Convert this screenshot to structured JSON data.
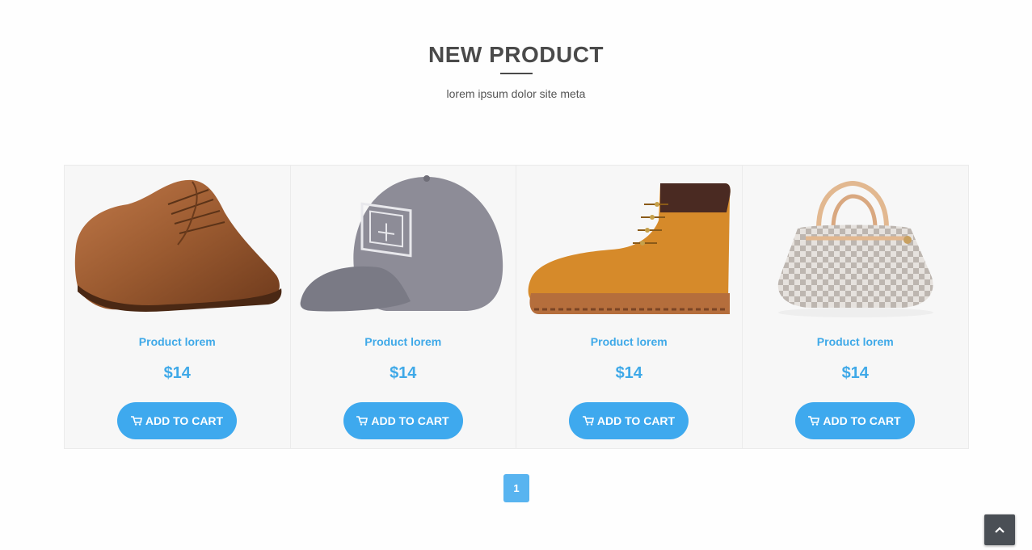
{
  "header": {
    "title": "NEW PRODUCT",
    "subtitle": "lorem ipsum dolor site meta"
  },
  "products": [
    {
      "name": "Product lorem",
      "price": "$14",
      "button_label": "ADD TO CART",
      "image": "brown-leather-shoe"
    },
    {
      "name": "Product lorem",
      "price": "$14",
      "button_label": "ADD TO CART",
      "image": "gray-baseball-cap"
    },
    {
      "name": "Product lorem",
      "price": "$14",
      "button_label": "ADD TO CART",
      "image": "tan-work-boot"
    },
    {
      "name": "Product lorem",
      "price": "$14",
      "button_label": "ADD TO CART",
      "image": "checkered-handbag"
    }
  ],
  "pagination": {
    "current_page": "1"
  },
  "back_to_top": {
    "icon": "chevron-up-icon"
  },
  "colors": {
    "accent": "#3ea9ee",
    "title": "#4a4a4a",
    "card_bg": "#f7f7f7"
  }
}
